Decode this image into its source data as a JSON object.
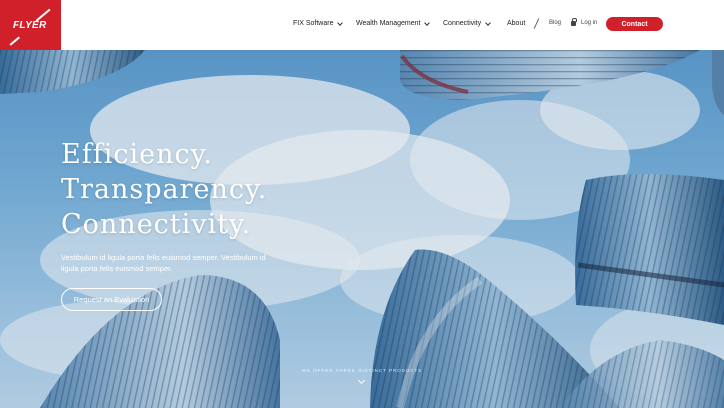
{
  "brand": {
    "name": "FLYER",
    "color": "#d0202a"
  },
  "nav": {
    "items": [
      {
        "label": "FIX Software",
        "has_dropdown": true
      },
      {
        "label": "Wealth Management",
        "has_dropdown": true
      },
      {
        "label": "Connectivity",
        "has_dropdown": true
      },
      {
        "label": "About",
        "has_dropdown": false
      }
    ],
    "blog": "Blog",
    "login": "Log in",
    "login_icon": "lock-icon",
    "contact": "Contact"
  },
  "hero": {
    "headline": [
      "Efficiency.",
      "Transparency.",
      "Connectivity."
    ],
    "subtext": "Vestibulum id ligula porta felis euismod semper. Vestibulum id ligula porta felis euismod semper.",
    "cta": "Request an Evaluation",
    "bottom_note": "WE OFFER THREE DISTINCT PRODUCTS",
    "scroll_icon": "chevron-down-icon"
  }
}
